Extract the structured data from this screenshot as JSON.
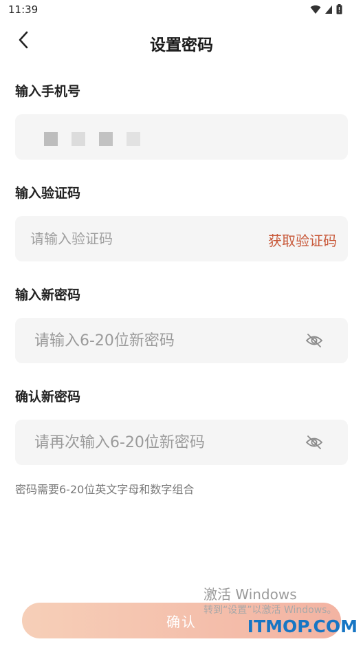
{
  "status_bar": {
    "time": "11:39"
  },
  "nav": {
    "title": "设置密码"
  },
  "phone": {
    "label": "输入手机号",
    "value": ""
  },
  "verification": {
    "label": "输入验证码",
    "placeholder": "请输入验证码",
    "get_code_label": "获取验证码"
  },
  "new_password": {
    "label": "输入新密码",
    "placeholder": "请输入6-20位新密码"
  },
  "confirm_password": {
    "label": "确认新密码",
    "placeholder": "请再次输入6-20位新密码"
  },
  "hint": "密码需要6-20位英文字母和数字组合",
  "confirm_button_label": "确认",
  "overlay": {
    "activation_title": "激活 Windows",
    "activation_sub": "转到“设置”以激活 Windows。",
    "site": "ITMOP.COM"
  },
  "colors": {
    "accent": "#c8593a",
    "button_start": "#f6cfb8",
    "button_end": "#f3b3a2",
    "field_bg": "#f5f5f5"
  },
  "icons": {
    "back": "chevron-left-icon",
    "eye": "eye-off-icon",
    "wifi": "wifi-icon",
    "signal": "signal-icon",
    "battery": "battery-icon"
  }
}
